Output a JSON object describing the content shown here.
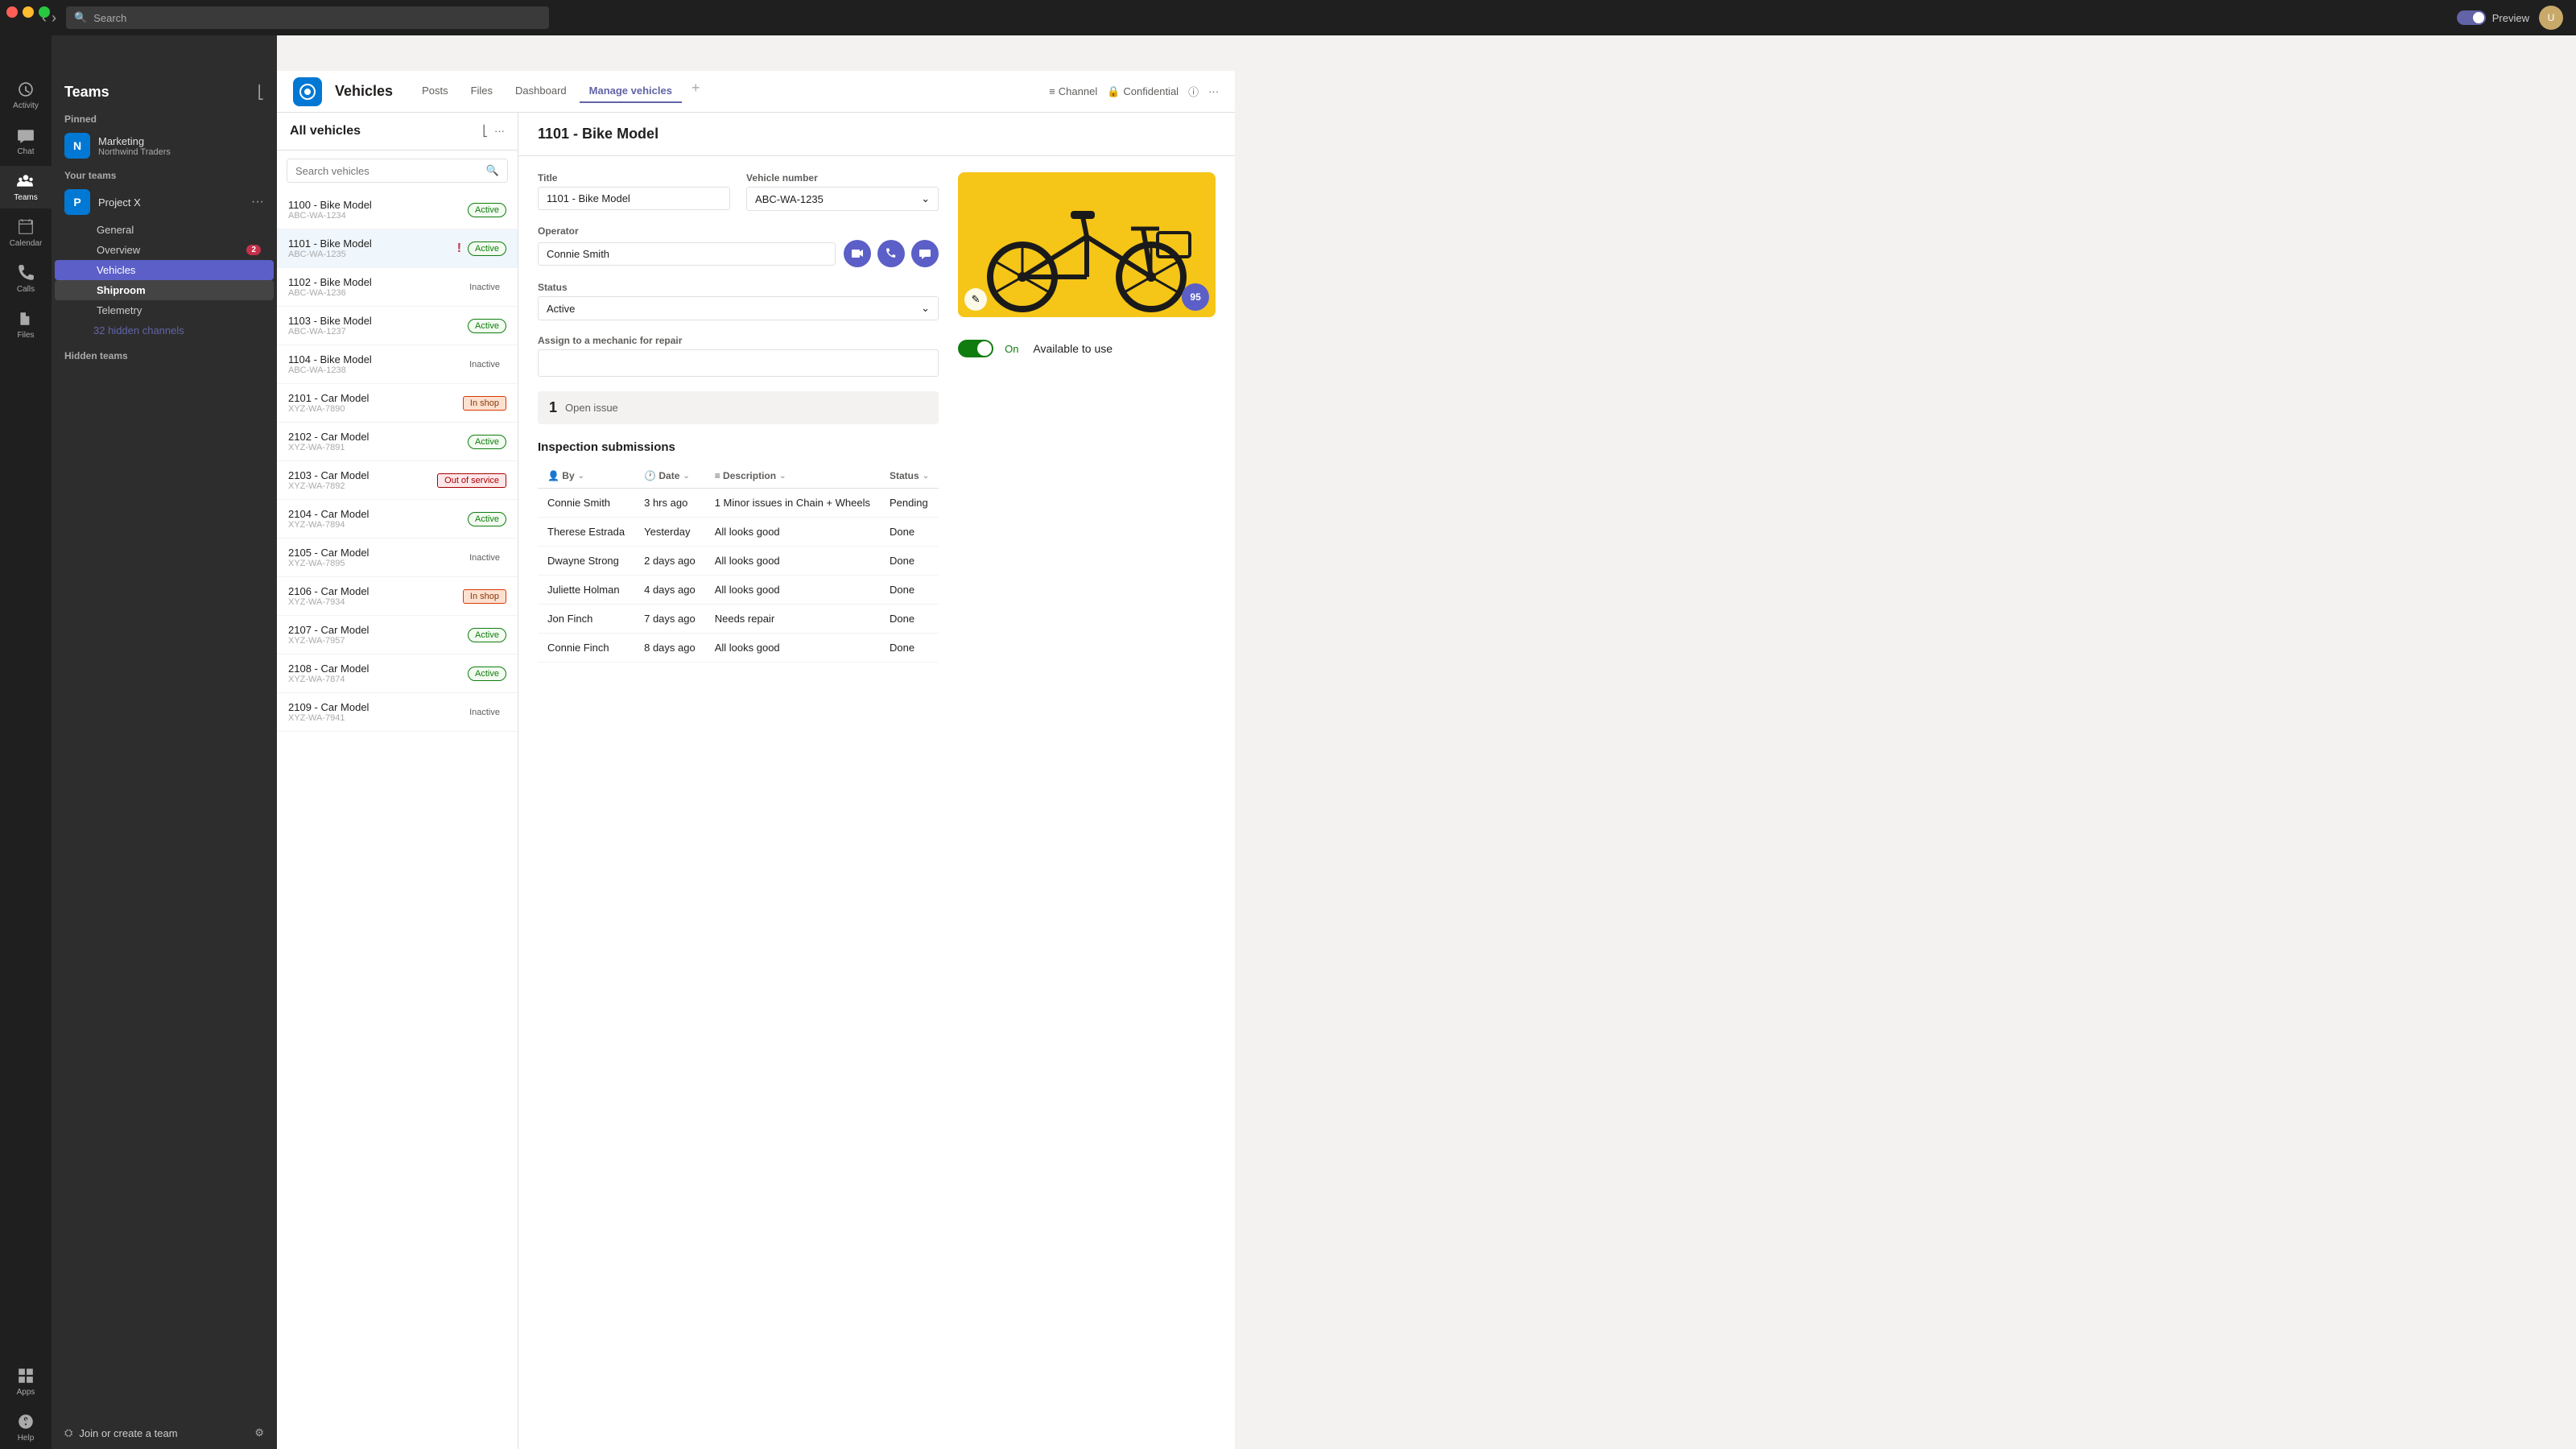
{
  "topbar": {
    "search_placeholder": "Search",
    "preview_label": "Preview",
    "toggle_state": "on"
  },
  "sidebar_icons": [
    {
      "name": "Activity",
      "label": "Activity",
      "icon": "activity",
      "active": false
    },
    {
      "name": "Chat",
      "label": "Chat",
      "icon": "chat",
      "active": false
    },
    {
      "name": "Teams",
      "label": "Teams",
      "icon": "teams",
      "active": true
    },
    {
      "name": "Calendar",
      "label": "Calendar",
      "icon": "calendar",
      "active": false
    },
    {
      "name": "Calls",
      "label": "Calls",
      "icon": "calls",
      "active": false
    },
    {
      "name": "Files",
      "label": "Files",
      "icon": "files",
      "active": false
    },
    {
      "name": "PowerApps",
      "label": "Apps",
      "icon": "apps",
      "active": false
    },
    {
      "name": "Help",
      "label": "Help",
      "icon": "help",
      "active": false
    }
  ],
  "teams_sidebar": {
    "title": "Teams",
    "pinned_label": "Pinned",
    "pinned_teams": [
      {
        "name": "Marketing",
        "sub": "Northwind Traders"
      }
    ],
    "your_teams_label": "Your teams",
    "teams": [
      {
        "name": "Project X",
        "channels": [
          "General",
          "Overview",
          "Vehicles",
          "Shiproom",
          "Telemetry"
        ],
        "active_channel": "Vehicles",
        "overview_badge": 2
      }
    ],
    "hidden_channels_label": "32 hidden channels",
    "hidden_teams_label": "Hidden teams",
    "join_label": "Join or create a team"
  },
  "app_header": {
    "icon_letter": "V",
    "app_name": "Vehicles",
    "tabs": [
      "Posts",
      "Files",
      "Dashboard",
      "Manage vehicles"
    ],
    "active_tab": "Manage vehicles",
    "channel_label": "Channel",
    "confidential_label": "Confidential"
  },
  "vehicle_list": {
    "title": "All vehicles",
    "search_placeholder": "Search vehicles",
    "vehicles": [
      {
        "id": "1100 - Bike Model",
        "code": "ABC-WA-1234",
        "status": "Active",
        "status_key": "active"
      },
      {
        "id": "1101 - Bike Model",
        "code": "ABC-WA-1235",
        "status": "Active",
        "status_key": "active",
        "selected": true,
        "alert": true
      },
      {
        "id": "1102 - Bike Model",
        "code": "ABC-WA-1236",
        "status": "Inactive",
        "status_key": "inactive"
      },
      {
        "id": "1103 - Bike Model",
        "code": "ABC-WA-1237",
        "status": "Active",
        "status_key": "active"
      },
      {
        "id": "1104 - Bike Model",
        "code": "ABC-WA-1238",
        "status": "Inactive",
        "status_key": "inactive"
      },
      {
        "id": "2101 - Car Model",
        "code": "XYZ-WA-7890",
        "status": "In shop",
        "status_key": "inshop"
      },
      {
        "id": "2102 - Car Model",
        "code": "XYZ-WA-7891",
        "status": "Active",
        "status_key": "active"
      },
      {
        "id": "2103 - Car Model",
        "code": "XYZ-WA-7892",
        "status": "Out of service",
        "status_key": "outofservice"
      },
      {
        "id": "2104 - Car Model",
        "code": "XYZ-WA-7894",
        "status": "Active",
        "status_key": "active"
      },
      {
        "id": "2105 - Car Model",
        "code": "XYZ-WA-7895",
        "status": "Inactive",
        "status_key": "inactive"
      },
      {
        "id": "2106 - Car Model",
        "code": "XYZ-WA-7934",
        "status": "In shop",
        "status_key": "inshop"
      },
      {
        "id": "2107 - Car Model",
        "code": "XYZ-WA-7957",
        "status": "Active",
        "status_key": "active"
      },
      {
        "id": "2108 - Car Model",
        "code": "XYZ-WA-7874",
        "status": "Active",
        "status_key": "active"
      },
      {
        "id": "2109 - Car Model",
        "code": "XYZ-WA-7941",
        "status": "Inactive",
        "status_key": "inactive"
      }
    ]
  },
  "detail": {
    "title": "1101 - Bike Model",
    "fields": {
      "title_label": "Title",
      "title_value": "1101 - Bike Model",
      "vehicle_number_label": "Vehicle number",
      "vehicle_number_value": "ABC-WA-1235",
      "operator_label": "Operator",
      "operator_value": "Connie Smith",
      "status_label": "Status",
      "status_value": "Active",
      "assign_label": "Assign to a mechanic for repair",
      "assign_value": ""
    },
    "open_issues": {
      "count": "1",
      "label": "Open issue"
    },
    "inspection_title": "Inspection submissions",
    "inspection_columns": [
      "By",
      "Date",
      "Description",
      "Status"
    ],
    "inspections": [
      {
        "by": "Connie Smith",
        "date": "3 hrs ago",
        "description": "1 Minor issues in Chain + Wheels",
        "status": "Pending",
        "status_key": "pending"
      },
      {
        "by": "Therese Estrada",
        "date": "Yesterday",
        "description": "All looks good",
        "status": "Done",
        "status_key": "done"
      },
      {
        "by": "Dwayne Strong",
        "date": "2 days ago",
        "description": "All looks good",
        "status": "Done",
        "status_key": "done"
      },
      {
        "by": "Juliette Holman",
        "date": "4 days ago",
        "description": "All looks good",
        "status": "Done",
        "status_key": "done"
      },
      {
        "by": "Jon Finch",
        "date": "7 days ago",
        "description": "Needs repair",
        "status": "Done",
        "status_key": "done"
      },
      {
        "by": "Connie Finch",
        "date": "8 days ago",
        "description": "All looks good",
        "status": "Done",
        "status_key": "done"
      }
    ],
    "image": {
      "score": "95",
      "available_label": "Available to use",
      "available_on": "On"
    }
  }
}
